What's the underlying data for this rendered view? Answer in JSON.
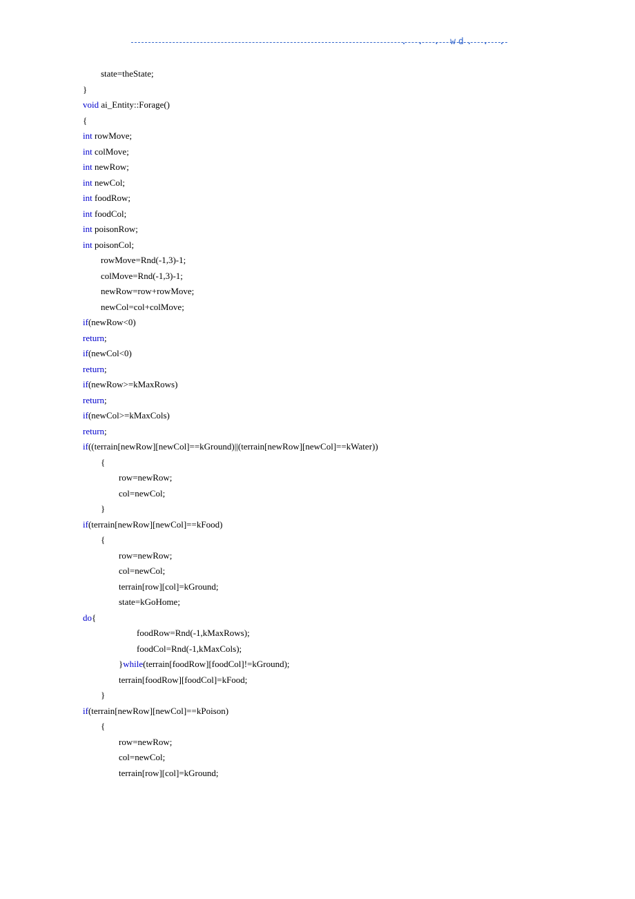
{
  "header": ". . . wd. . .",
  "code": [
    {
      "indent": 1,
      "tokens": [
        [
          "",
          "state=theState;"
        ]
      ]
    },
    {
      "indent": 0,
      "tokens": [
        [
          "",
          "}"
        ]
      ]
    },
    {
      "indent": 0,
      "tokens": [
        [
          "kw",
          "void"
        ],
        [
          "",
          " ai_Entity::Forage()"
        ]
      ]
    },
    {
      "indent": 0,
      "tokens": [
        [
          "",
          "{"
        ]
      ]
    },
    {
      "indent": 0,
      "tokens": [
        [
          "kw",
          "int"
        ],
        [
          "",
          " rowMove;"
        ]
      ]
    },
    {
      "indent": 0,
      "tokens": [
        [
          "kw",
          "int"
        ],
        [
          "",
          " colMove;"
        ]
      ]
    },
    {
      "indent": 0,
      "tokens": [
        [
          "kw",
          "int"
        ],
        [
          "",
          " newRow;"
        ]
      ]
    },
    {
      "indent": 0,
      "tokens": [
        [
          "kw",
          "int"
        ],
        [
          "",
          " newCol;"
        ]
      ]
    },
    {
      "indent": 0,
      "tokens": [
        [
          "kw",
          "int"
        ],
        [
          "",
          " foodRow;"
        ]
      ]
    },
    {
      "indent": 0,
      "tokens": [
        [
          "kw",
          "int"
        ],
        [
          "",
          " foodCol;"
        ]
      ]
    },
    {
      "indent": 0,
      "tokens": [
        [
          "kw",
          "int"
        ],
        [
          "",
          " poisonRow;"
        ]
      ]
    },
    {
      "indent": 0,
      "tokens": [
        [
          "kw",
          "int"
        ],
        [
          "",
          " poisonCol;"
        ]
      ]
    },
    {
      "indent": 1,
      "tokens": [
        [
          "",
          "rowMove=Rnd(-1,3)-1;"
        ]
      ]
    },
    {
      "indent": 1,
      "tokens": [
        [
          "",
          "colMove=Rnd(-1,3)-1;"
        ]
      ]
    },
    {
      "indent": 1,
      "tokens": [
        [
          "",
          "newRow=row+rowMove;"
        ]
      ]
    },
    {
      "indent": 1,
      "tokens": [
        [
          "",
          "newCol=col+colMove;"
        ]
      ]
    },
    {
      "indent": 0,
      "tokens": [
        [
          "kw",
          "if"
        ],
        [
          "",
          "(newRow<0)"
        ]
      ]
    },
    {
      "indent": 0,
      "tokens": [
        [
          "kw",
          "return"
        ],
        [
          "",
          ";"
        ]
      ]
    },
    {
      "indent": 0,
      "tokens": [
        [
          "kw",
          "if"
        ],
        [
          "",
          "(newCol<0)"
        ]
      ]
    },
    {
      "indent": 0,
      "tokens": [
        [
          "kw",
          "return"
        ],
        [
          "",
          ";"
        ]
      ]
    },
    {
      "indent": 0,
      "tokens": [
        [
          "kw",
          "if"
        ],
        [
          "",
          "(newRow>=kMaxRows)"
        ]
      ]
    },
    {
      "indent": 0,
      "tokens": [
        [
          "kw",
          "return"
        ],
        [
          "",
          ";"
        ]
      ]
    },
    {
      "indent": 0,
      "tokens": [
        [
          "kw",
          "if"
        ],
        [
          "",
          "(newCol>=kMaxCols)"
        ]
      ]
    },
    {
      "indent": 0,
      "tokens": [
        [
          "kw",
          "return"
        ],
        [
          "",
          ";"
        ]
      ]
    },
    {
      "indent": 0,
      "tokens": [
        [
          "kw",
          "if"
        ],
        [
          "",
          "((terrain[newRow][newCol]==kGround)||(terrain[newRow][newCol]==kWater))"
        ]
      ]
    },
    {
      "indent": 1,
      "tokens": [
        [
          "",
          "{"
        ]
      ]
    },
    {
      "indent": 2,
      "tokens": [
        [
          "",
          "row=newRow;"
        ]
      ]
    },
    {
      "indent": 2,
      "tokens": [
        [
          "",
          "col=newCol;"
        ]
      ]
    },
    {
      "indent": 1,
      "tokens": [
        [
          "",
          "}"
        ]
      ]
    },
    {
      "indent": 0,
      "tokens": [
        [
          "kw",
          "if"
        ],
        [
          "",
          "(terrain[newRow][newCol]==kFood)"
        ]
      ]
    },
    {
      "indent": 1,
      "tokens": [
        [
          "",
          "{"
        ]
      ]
    },
    {
      "indent": 2,
      "tokens": [
        [
          "",
          "row=newRow;"
        ]
      ]
    },
    {
      "indent": 2,
      "tokens": [
        [
          "",
          "col=newCol;"
        ]
      ]
    },
    {
      "indent": 2,
      "tokens": [
        [
          "",
          "terrain[row][col]=kGround;"
        ]
      ]
    },
    {
      "indent": 2,
      "tokens": [
        [
          "",
          "state=kGoHome;"
        ]
      ]
    },
    {
      "indent": 0,
      "tokens": [
        [
          "kw",
          "do"
        ],
        [
          "",
          "{"
        ]
      ]
    },
    {
      "indent": 3,
      "tokens": [
        [
          "",
          "foodRow=Rnd(-1,kMaxRows);"
        ]
      ]
    },
    {
      "indent": 3,
      "tokens": [
        [
          "",
          "foodCol=Rnd(-1,kMaxCols);"
        ]
      ]
    },
    {
      "indent": 2,
      "tokens": [
        [
          "",
          "}"
        ],
        [
          "kw",
          "while"
        ],
        [
          "",
          "(terrain[foodRow][foodCol]!=kGround);"
        ]
      ]
    },
    {
      "indent": 2,
      "tokens": [
        [
          "",
          "terrain[foodRow][foodCol]=kFood;"
        ]
      ]
    },
    {
      "indent": 1,
      "tokens": [
        [
          "",
          "}"
        ]
      ]
    },
    {
      "indent": 0,
      "tokens": [
        [
          "kw",
          "if"
        ],
        [
          "",
          "(terrain[newRow][newCol]==kPoison)"
        ]
      ]
    },
    {
      "indent": 1,
      "tokens": [
        [
          "",
          "{"
        ]
      ]
    },
    {
      "indent": 2,
      "tokens": [
        [
          "",
          "row=newRow;"
        ]
      ]
    },
    {
      "indent": 2,
      "tokens": [
        [
          "",
          "col=newCol;"
        ]
      ]
    },
    {
      "indent": 2,
      "tokens": [
        [
          "",
          "terrain[row][col]=kGround;"
        ]
      ]
    }
  ]
}
